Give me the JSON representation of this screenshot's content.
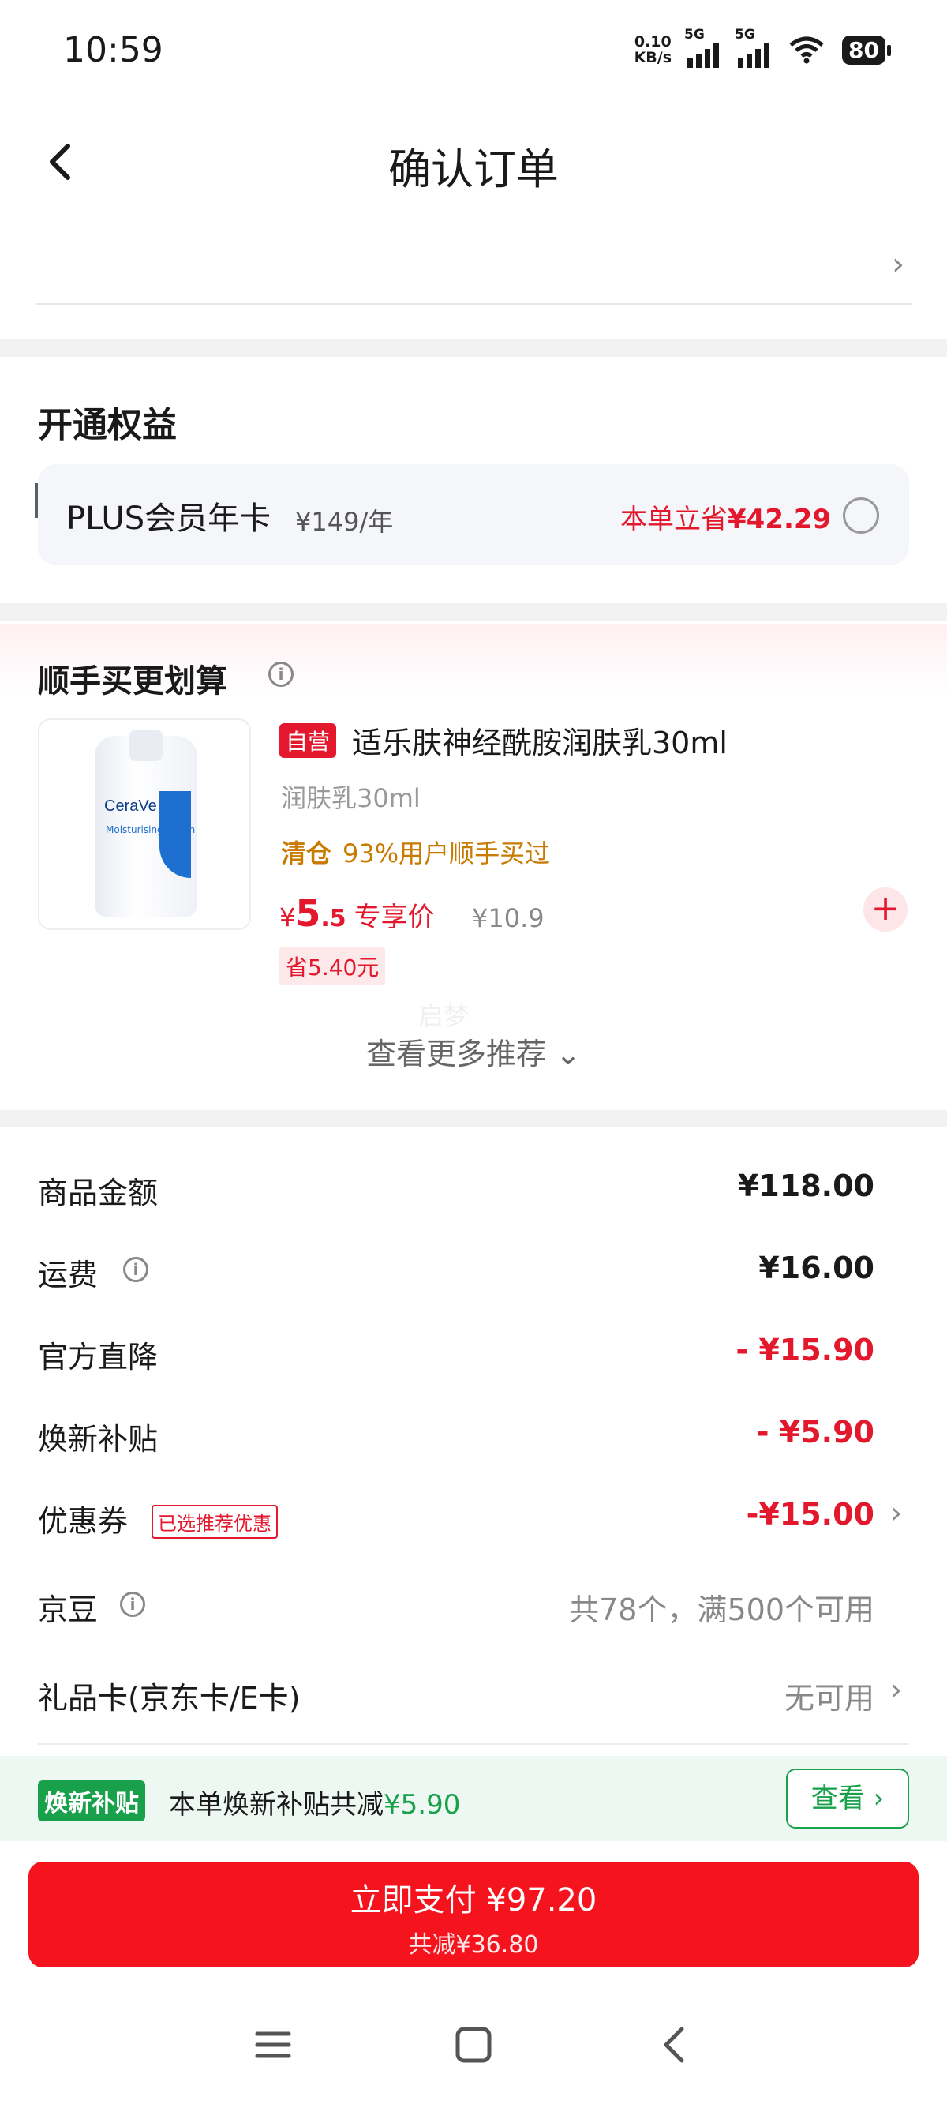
{
  "status_bar": {
    "time": "10:59",
    "net_speed_top": "0.10",
    "net_speed_bottom": "KB/s",
    "signal1_label": "5G",
    "signal2_label": "5G",
    "battery": "80"
  },
  "header": {
    "title": "确认订单",
    "back_icon": "chevron-left-icon"
  },
  "benefits": {
    "section_title": "开通权益",
    "plus_name": "PLUS会员年卡",
    "plus_price": "¥149/年",
    "save_prefix": "本单立省",
    "save_amount": "¥42.29"
  },
  "recommend": {
    "section_title": "顺手买更划算",
    "product": {
      "self_tag": "自营",
      "title": "适乐肤神经酰胺润肤乳30ml",
      "spec": "润肤乳30ml",
      "clear_tag": "清仓",
      "buy_rate": "93%用户顺手买过",
      "price_symbol": "¥",
      "price_int": "5",
      "price_dec": ".5",
      "price_label": "专享价",
      "orig_price": "¥10.9",
      "save_tag": "省5.40元",
      "image_brand": "CeraVe",
      "image_sub": "Moisturising Lotion"
    },
    "watermark": "启梦",
    "more_label": "查看更多推荐 ⌄"
  },
  "summary": {
    "rows": [
      {
        "label": "商品金额",
        "value": "¥118.00"
      },
      {
        "label": "运费",
        "value": "¥16.00"
      },
      {
        "label": "官方直降",
        "value": "- ¥15.90"
      },
      {
        "label": "焕新补贴",
        "value": "- ¥5.90"
      },
      {
        "label": "优惠券",
        "tag": "已选推荐优惠",
        "value": "-¥15.00"
      },
      {
        "label": "京豆",
        "value": "共78个，满500个可用"
      },
      {
        "label": "礼品卡(京东卡/E卡)",
        "value": "无可用"
      }
    ]
  },
  "subsidy": {
    "tag": "焕新补贴",
    "text": "本单焕新补贴共减",
    "amount": "¥5.90",
    "view_label": "查看 ›"
  },
  "pay": {
    "main": "立即支付 ¥97.20",
    "sub": "共减¥36.80"
  },
  "nav": {
    "menu_icon": "menu-icon",
    "home_icon": "home-icon",
    "back_icon": "back-icon"
  },
  "colors": {
    "accent_red": "#e3182d",
    "pay_red": "#f5141e",
    "subsidy_green": "#19a04b",
    "clear_orange": "#c97a00"
  }
}
